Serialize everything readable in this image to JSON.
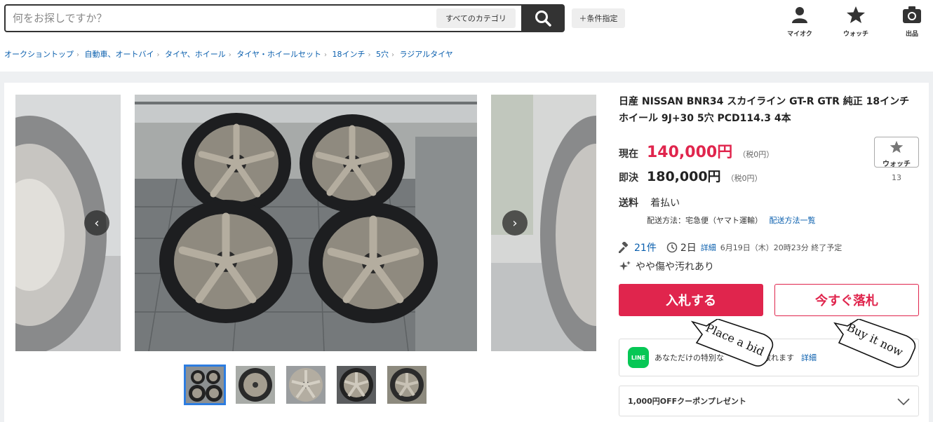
{
  "header": {
    "search_placeholder": "何をお探しですか？",
    "category_select": "すべてのカテゴリ",
    "condition_button": "＋条件指定",
    "icons": [
      {
        "name": "person-icon",
        "label": "マイオク"
      },
      {
        "name": "star-icon",
        "label": "ウォッチ"
      },
      {
        "name": "camera-icon",
        "label": "出品"
      }
    ]
  },
  "breadcrumb": [
    "オークショントップ",
    "自動車、オートバイ",
    "タイヤ、ホイール",
    "タイヤ・ホイールセット",
    "18インチ",
    "5穴",
    "ラジアルタイヤ"
  ],
  "product": {
    "title": "日産 NISSAN BNR34 スカイライン GT-R GTR 純正 18インチホイール 9J+30 5穴 PCD114.3 4本",
    "current_label": "現在",
    "current_price": "140,000円",
    "current_tax": "（税0円）",
    "buyout_label": "即決",
    "buyout_price": "180,000円",
    "buyout_tax": "（税0円）",
    "watch_label": "ウォッチ",
    "watch_count": "13",
    "shipping_label": "送料",
    "shipping_value": "着払い",
    "shipping_method": "配送方法：宅急便（ヤマト運輸）",
    "shipping_link": "配送方法一覧",
    "bids": "21件",
    "time_left": "2日",
    "detail_link": "詳細",
    "end_time": "6月19日（木）20時23分 終了予定",
    "condition": "やや傷や汚れあり",
    "bid_button": "入札する",
    "buynow_button": "今すぐ落札",
    "line_logo": "LINE",
    "line_text_a": "あなただけの特別な",
    "line_text_b": "受け取れます",
    "line_link": "詳細",
    "coupon_text": "1,000円OFFクーポンプレゼント"
  },
  "callouts": {
    "bid": "Place a bid",
    "buynow": "Buy it now"
  },
  "colors": {
    "accent": "#e0254d",
    "link": "#0a5fae",
    "thumb_active": "#2d7de0",
    "line_green": "#06c755"
  }
}
